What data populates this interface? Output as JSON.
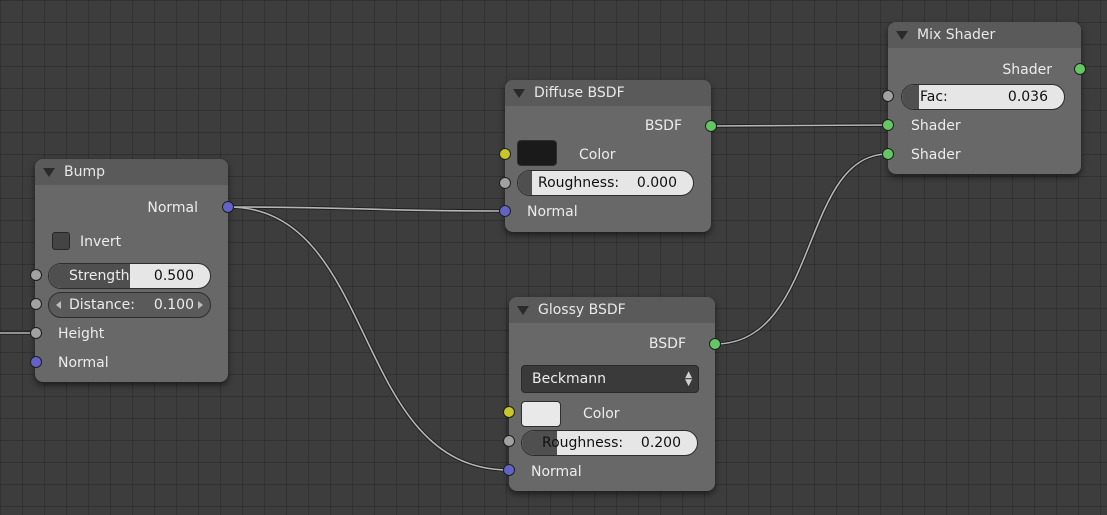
{
  "colors": {
    "background": "#3d3d3d",
    "node_body": "#686868",
    "node_header": "#5a5a5a",
    "socket_shader": "#63c763",
    "socket_color": "#c7c729",
    "socket_value": "#a1a1a1",
    "socket_vector": "#6363c7",
    "link": "#b5b5b5"
  },
  "nodes": {
    "bump": {
      "title": "Bump",
      "output_normal": "Normal",
      "invert_label": "Invert",
      "invert_checked": false,
      "strength": {
        "label": "Strength:",
        "value": "0.500",
        "fill": 0.5
      },
      "distance": {
        "label": "Distance:",
        "value": "0.100"
      },
      "input_height": "Height",
      "input_normal": "Normal"
    },
    "diffuse": {
      "title": "Diffuse BSDF",
      "output_bsdf": "BSDF",
      "color_label": "Color",
      "color_value": "#1a1a1a",
      "roughness": {
        "label": "Roughness:",
        "value": "0.000",
        "fill": 0.0
      },
      "input_normal": "Normal"
    },
    "glossy": {
      "title": "Glossy BSDF",
      "output_bsdf": "BSDF",
      "distribution": "Beckmann",
      "color_label": "Color",
      "color_value": "#e9e9e9",
      "roughness": {
        "label": "Roughness:",
        "value": "0.200",
        "fill": 0.2
      },
      "input_normal": "Normal"
    },
    "mix": {
      "title": "Mix Shader",
      "output_shader": "Shader",
      "fac": {
        "label": "Fac:",
        "value": "0.036",
        "fill": 0.036
      },
      "input_shader_1": "Shader",
      "input_shader_2": "Shader"
    }
  }
}
